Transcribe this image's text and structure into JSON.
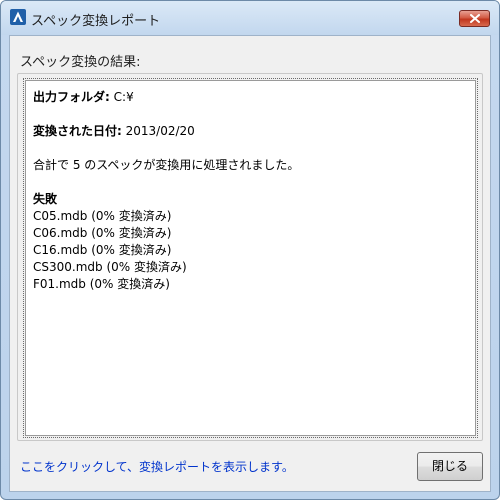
{
  "window": {
    "title": "スペック変換レポート",
    "icon": "autodesk-a-icon"
  },
  "dialog": {
    "heading": "スペック変換の結果:",
    "report": {
      "output_folder_label": "出力フォルダ:",
      "output_folder_value": "C:¥",
      "date_label": "変換された日付:",
      "date_value": "2013/02/20",
      "summary": "合計で 5 のスペックが変換用に処理されました。",
      "failed_heading": "失敗",
      "failed_items": [
        "C05.mdb (0% 変換済み)",
        "C06.mdb (0% 変換済み)",
        "C16.mdb (0% 変換済み)",
        "CS300.mdb (0% 変換済み)",
        "F01.mdb (0% 変換済み)"
      ]
    },
    "link_text": "ここをクリックして、変換レポートを表示します。",
    "close_button_label": "閉じる"
  },
  "colors": {
    "link": "#0033cc",
    "close_button": "#c1371f"
  }
}
